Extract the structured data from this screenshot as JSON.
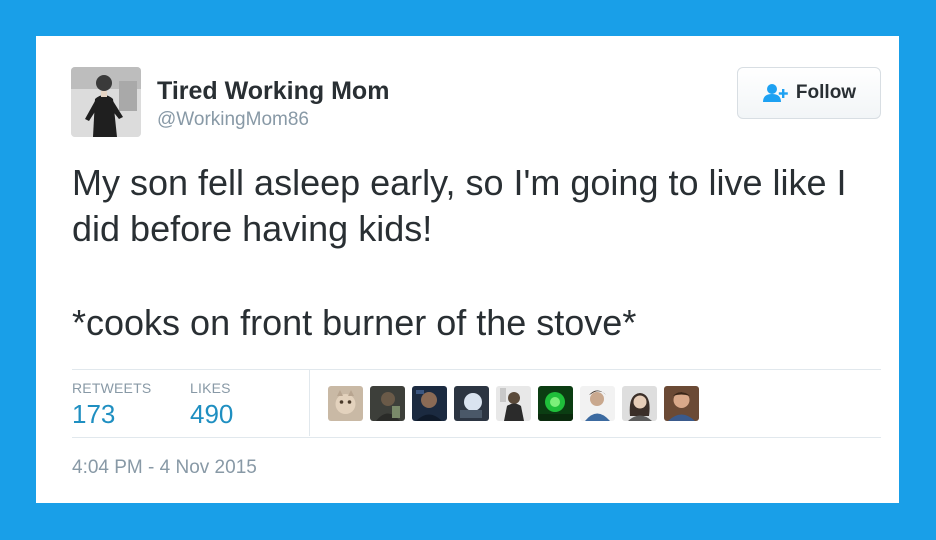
{
  "tweet": {
    "author_name": "Tired Working Mom",
    "author_handle": "@WorkingMom86",
    "follow_label": "Follow",
    "text_lines": [
      "My son fell asleep early, so I'm going to live like I did before having kids!",
      "*cooks on front burner of the stove*"
    ],
    "stats": {
      "retweets_label": "RETWEETS",
      "retweets_count": "173",
      "likes_label": "LIKES",
      "likes_count": "490"
    },
    "liker_count": 9,
    "timestamp": "4:04 PM - 4 Nov 2015"
  },
  "colors": {
    "background": "#199fe8",
    "card": "#ffffff",
    "text": "#292f33",
    "muted": "#8899a6",
    "accent": "#1f8fc1",
    "follow_icon": "#1da1f2"
  },
  "icons": {
    "follow": "add-user-icon"
  }
}
